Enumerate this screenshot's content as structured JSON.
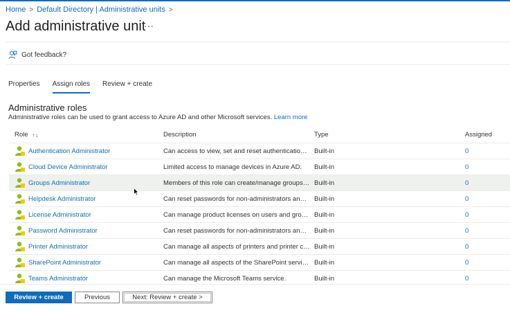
{
  "breadcrumb": {
    "home": "Home",
    "directory": "Default Directory | Administrative units"
  },
  "page": {
    "title": "Add administrative unit",
    "more": "···"
  },
  "feedback": {
    "label": "Got feedback?",
    "icon": "feedback-icon"
  },
  "tabs": [
    {
      "label": "Properties",
      "active": false
    },
    {
      "label": "Assign roles",
      "active": true
    },
    {
      "label": "Review + create",
      "active": false
    }
  ],
  "section": {
    "title": "Administrative roles",
    "description": "Administrative roles can be used to grant access to Azure AD and other Microsoft services.",
    "learn_more": "Learn more"
  },
  "table": {
    "headers": {
      "role": "Role",
      "sort_icon": "↑↓",
      "description": "Description",
      "type": "Type",
      "assigned": "Assigned"
    },
    "rows": [
      {
        "role": "Authentication Administrator",
        "description": "Can access to view, set and reset authentication ...",
        "type": "Built-in",
        "assigned": "0"
      },
      {
        "role": "Cloud Device Administrator",
        "description": "Limited access to manage devices in Azure AD.",
        "type": "Built-in",
        "assigned": "0"
      },
      {
        "role": "Groups Administrator",
        "description": "Members of this role can create/manage groups, ...",
        "type": "Built-in",
        "assigned": "0"
      },
      {
        "role": "Helpdesk Administrator",
        "description": "Can reset passwords for non-administrators and ...",
        "type": "Built-in",
        "assigned": "0"
      },
      {
        "role": "License Administrator",
        "description": "Can manage product licenses on users and groups.",
        "type": "Built-in",
        "assigned": "0"
      },
      {
        "role": "Password Administrator",
        "description": "Can reset passwords for non-administrators and ...",
        "type": "Built-in",
        "assigned": "0"
      },
      {
        "role": "Printer Administrator",
        "description": "Can manage all aspects of printers and printer co...",
        "type": "Built-in",
        "assigned": "0"
      },
      {
        "role": "SharePoint Administrator",
        "description": "Can manage all aspects of the SharePoint service.",
        "type": "Built-in",
        "assigned": "0"
      },
      {
        "role": "Teams Administrator",
        "description": "Can manage the Microsoft Teams service.",
        "type": "Built-in",
        "assigned": "0"
      }
    ]
  },
  "footer": {
    "review_create": "Review + create",
    "previous": "Previous",
    "next": "Next: Review + create >"
  },
  "colors": {
    "accent": "#0f6cbd",
    "role_icon_green": "#8cbd18",
    "role_icon_yellow": "#f2c811"
  }
}
